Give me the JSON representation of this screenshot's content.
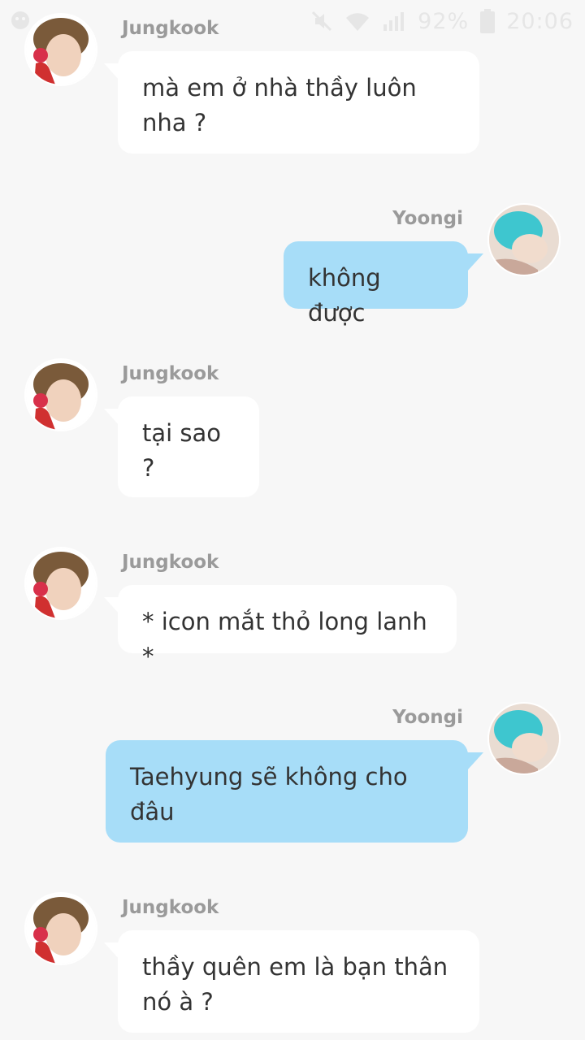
{
  "status_bar": {
    "battery_percent": "92%",
    "time": "20:06",
    "icons": [
      "notification-icon",
      "mute-icon",
      "wifi-icon",
      "signal-icon",
      "battery-icon"
    ]
  },
  "messages": [
    {
      "sender": "Jungkook",
      "side": "left",
      "text": "mà em ở nhà thầy luôn nha ?"
    },
    {
      "sender": "Yoongi",
      "side": "right",
      "text": "không được"
    },
    {
      "sender": "Jungkook",
      "side": "left",
      "text": "tại sao ?"
    },
    {
      "sender": "Jungkook",
      "side": "left",
      "text": "* icon mắt thỏ long lanh *"
    },
    {
      "sender": "Yoongi",
      "side": "right",
      "text": "Taehyung sẽ không cho đâu"
    },
    {
      "sender": "Jungkook",
      "side": "left",
      "text": "thầy quên em là bạn thân nó à ?"
    }
  ],
  "colors": {
    "background": "#f7f7f7",
    "left_bubble": "#ffffff",
    "right_bubble": "#a7ddf8",
    "name": "#9a9a9a",
    "text": "#333333"
  }
}
